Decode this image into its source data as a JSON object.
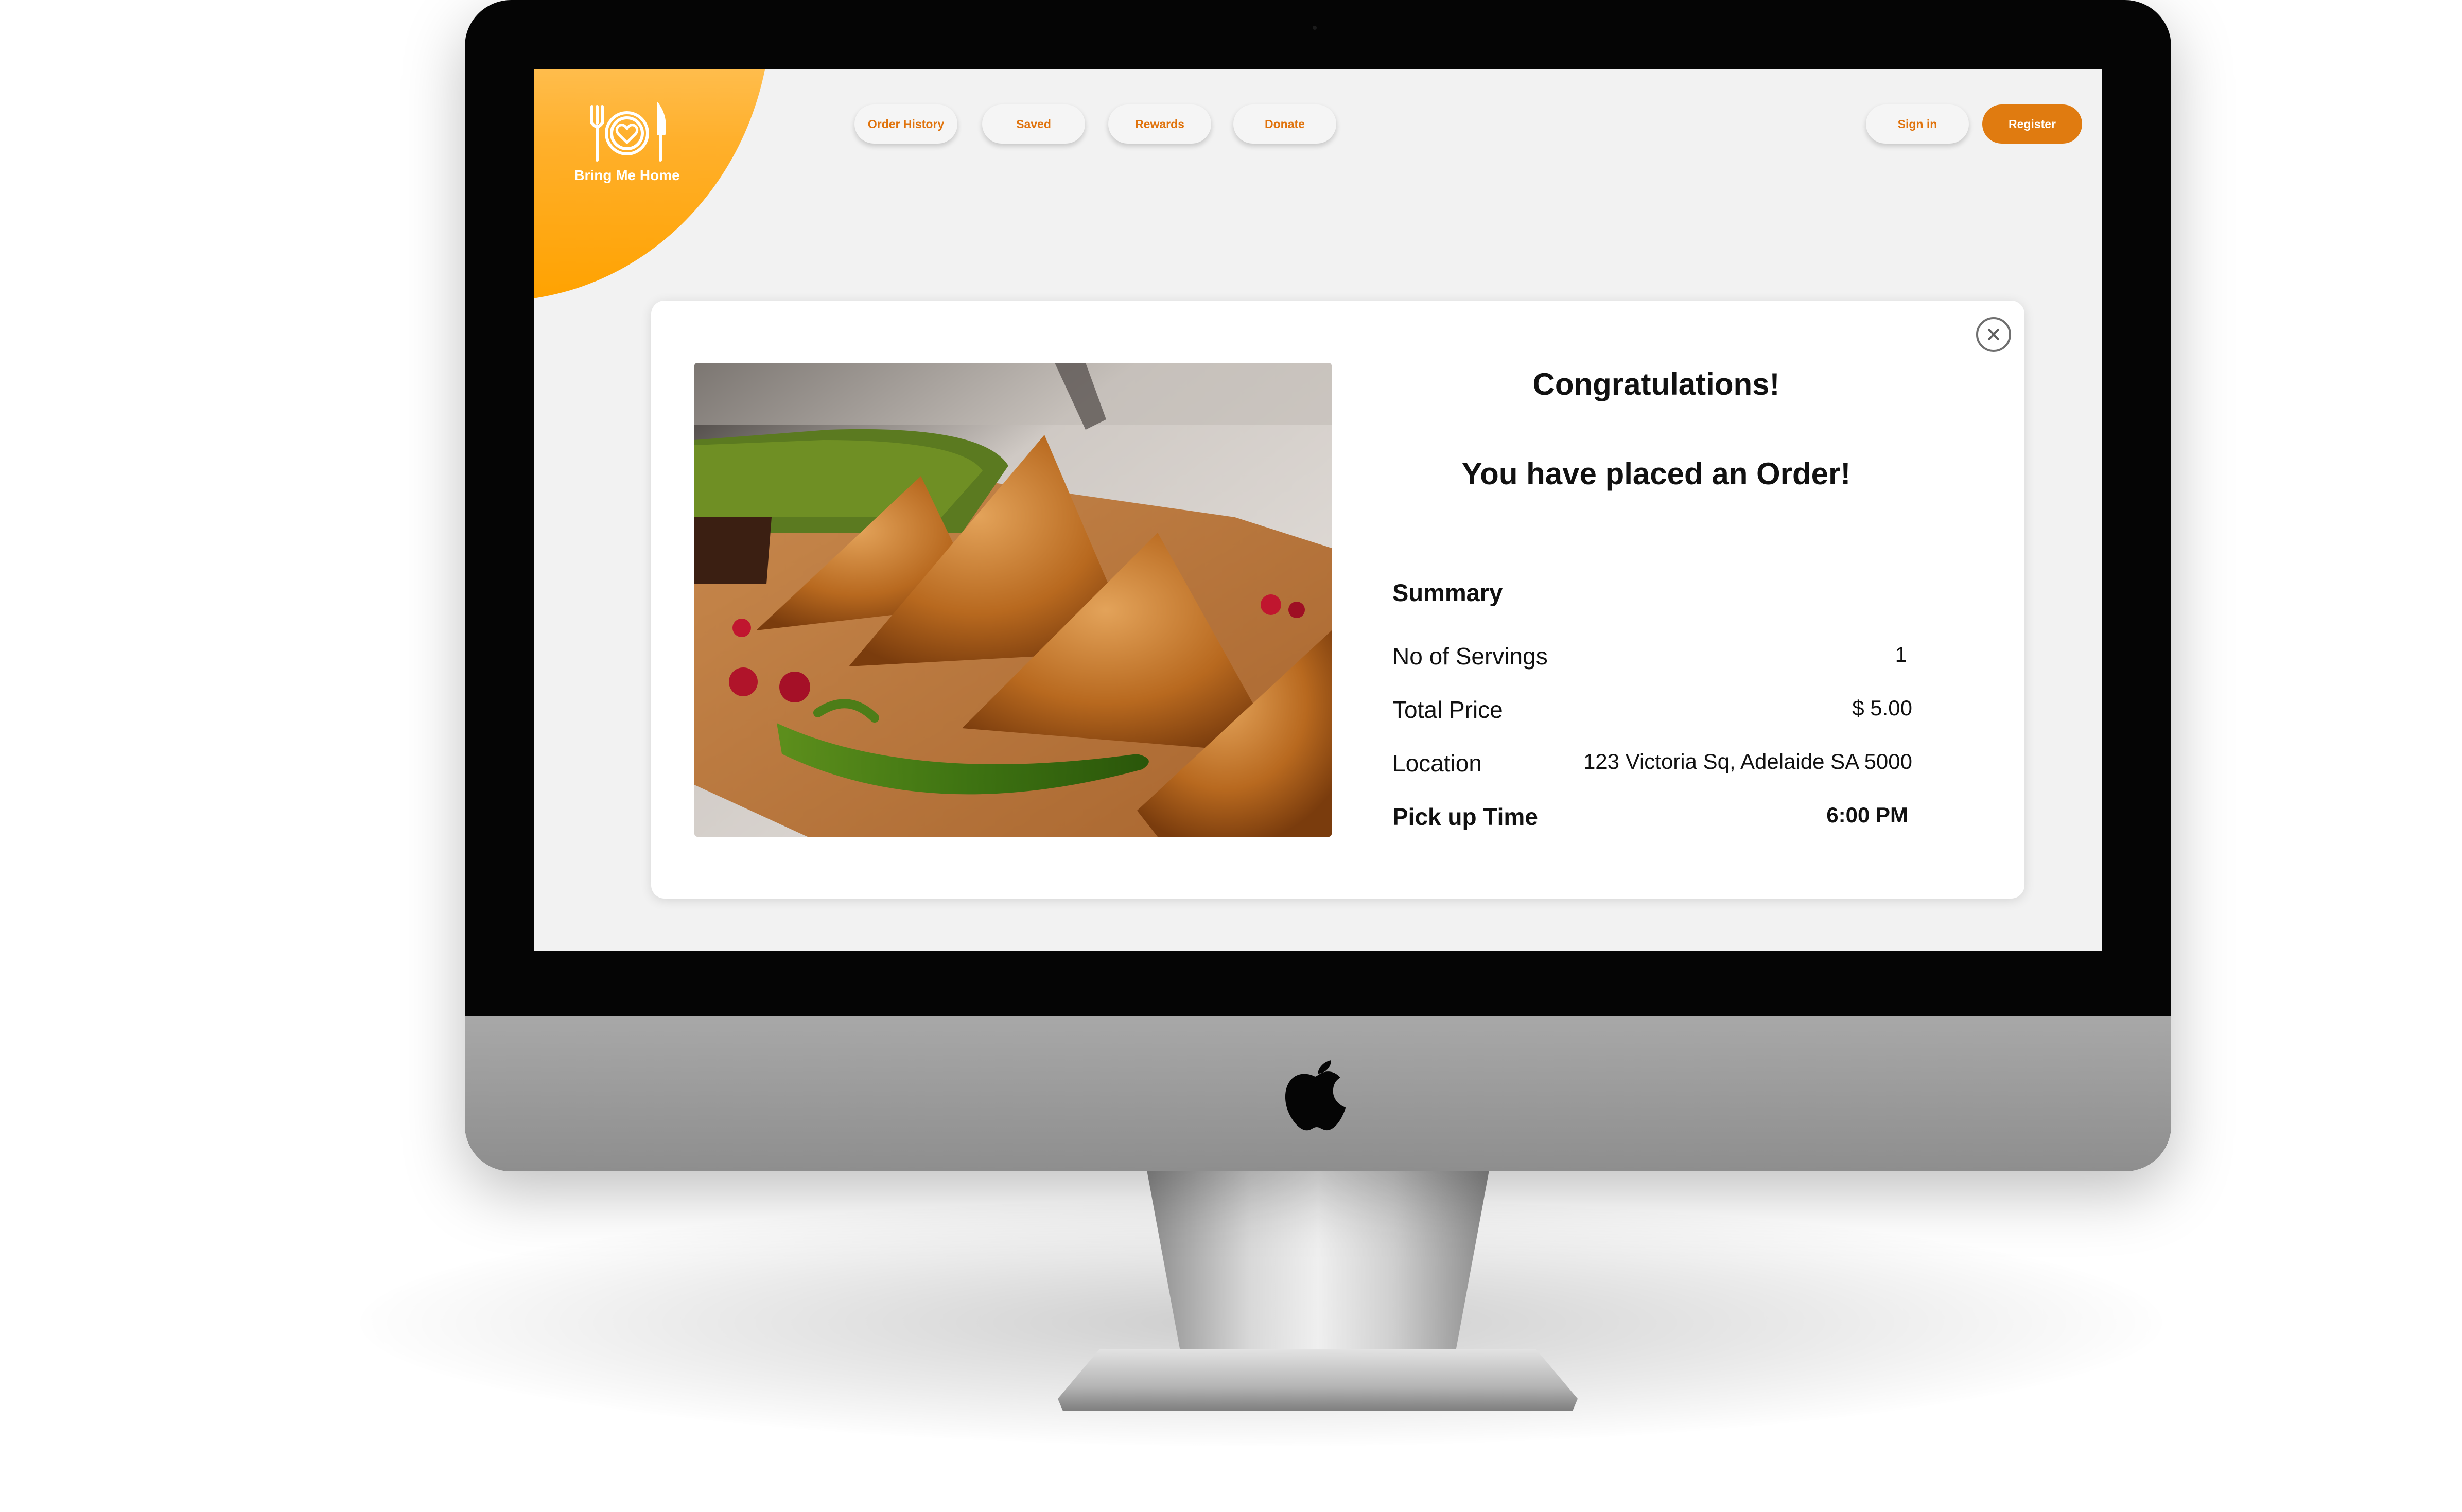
{
  "brand": {
    "name": "Bring Me Home",
    "accent": "#e07b10",
    "logo_gradient": [
      "#ffc868",
      "#ffa200"
    ]
  },
  "nav": {
    "items": [
      "Order History",
      "Saved",
      "Rewards",
      "Donate"
    ],
    "sign_in": "Sign in",
    "register": "Register"
  },
  "modal": {
    "title": "Congratulations!",
    "subtitle": "You have placed an Order!",
    "close_icon": "close-circle-icon",
    "image": "samosa-food-photo",
    "summary": {
      "heading": "Summary",
      "rows": [
        {
          "label": "No of Servings",
          "value": "1"
        },
        {
          "label": "Total Price",
          "value": "$ 5.00"
        },
        {
          "label": "Location",
          "value": "123 Victoria Sq, Adelaide SA 5000"
        },
        {
          "label": "Pick up Time",
          "value": "6:00 PM"
        }
      ]
    }
  }
}
